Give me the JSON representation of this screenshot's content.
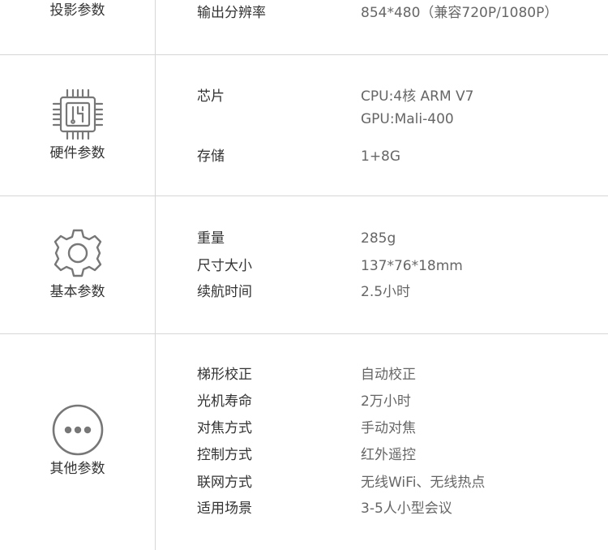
{
  "sections": [
    {
      "category": "投影参数",
      "icon": "projector-icon",
      "rows": [
        {
          "label": "输出分辨率",
          "value": "854*480（兼容720P/1080P）"
        }
      ]
    },
    {
      "category": "硬件参数",
      "icon": "chip-icon",
      "rows": [
        {
          "label": "芯片",
          "value": "CPU:4核 ARM V7",
          "value2": "GPU:Mali-400"
        },
        {
          "label": "存储",
          "value": "1+8G"
        }
      ]
    },
    {
      "category": "基本参数",
      "icon": "gear-icon",
      "rows": [
        {
          "label": "重量",
          "value": "285g"
        },
        {
          "label": "尺寸大小",
          "value": "137*76*18mm"
        },
        {
          "label": "续航时间",
          "value": "2.5小时"
        }
      ]
    },
    {
      "category": "其他参数",
      "icon": "more-dots-icon",
      "rows": [
        {
          "label": "梯形校正",
          "value": "自动校正"
        },
        {
          "label": "光机寿命",
          "value": "2万小时"
        },
        {
          "label": "对焦方式",
          "value": "手动对焦"
        },
        {
          "label": "控制方式",
          "value": "红外遥控"
        },
        {
          "label": "联网方式",
          "value": "无线WiFi、无线热点"
        },
        {
          "label": "适用场景",
          "value": "3-5人小型会议"
        }
      ]
    }
  ],
  "colors": {
    "icon": "#777777",
    "divider": "#d6d6d6",
    "label": "#333333",
    "value": "#666666"
  }
}
